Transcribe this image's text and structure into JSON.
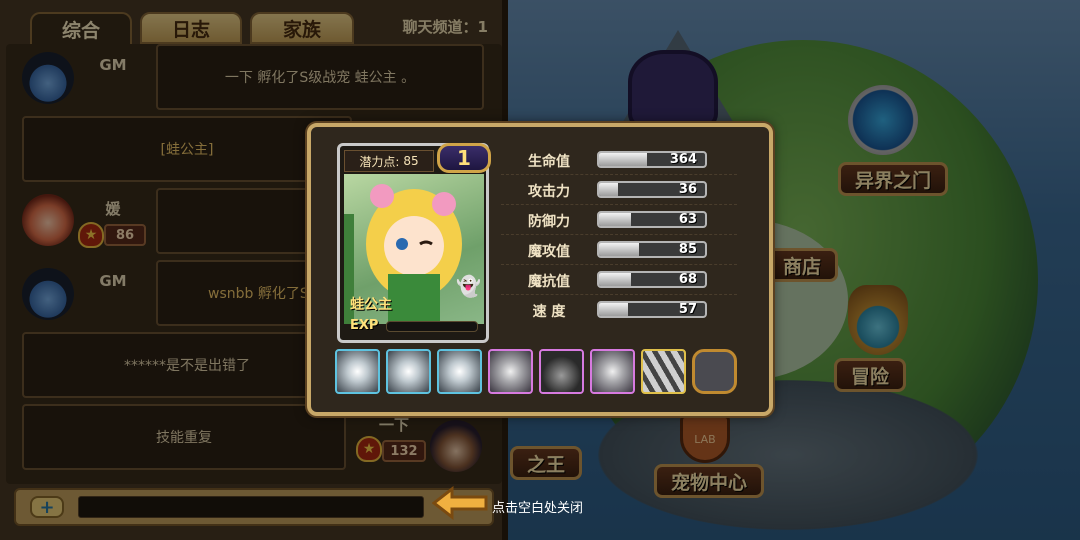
{
  "chat": {
    "tabs": [
      {
        "label": "综合",
        "active": true
      },
      {
        "label": "日志",
        "active": false
      },
      {
        "label": "家族",
        "active": false
      }
    ],
    "channel": "聊天频道：1",
    "messages": [
      {
        "sender": "GM",
        "text": "一下 孵化了S级战宠 蛙公主 。"
      },
      {
        "sender": "",
        "text": "[蛙公主]"
      },
      {
        "sender": "媛",
        "level": "86",
        "text": ""
      },
      {
        "sender": "GM",
        "text": "wsnbb 孵化了S"
      },
      {
        "sender": "",
        "text": "******是不是出错了"
      },
      {
        "sender": "一下",
        "level": "132",
        "text": "技能重复"
      }
    ],
    "input_placeholder": ""
  },
  "overlay": {
    "close_hint": "点击空白处关闭"
  },
  "pet": {
    "potential_label": "潜力点:",
    "potential_value": "85",
    "level": "1",
    "name": "蛙公主",
    "exp_label": "EXP",
    "exp_progress": 0.0,
    "stats": [
      {
        "label": "生命值",
        "value": 364,
        "fill": 0.45
      },
      {
        "label": "攻击力",
        "value": 36,
        "fill": 0.18
      },
      {
        "label": "防御力",
        "value": 63,
        "fill": 0.3
      },
      {
        "label": "魔攻值",
        "value": 85,
        "fill": 0.38
      },
      {
        "label": "魔抗值",
        "value": 68,
        "fill": 0.3
      },
      {
        "label": "速 度",
        "value": 57,
        "fill": 0.27
      }
    ],
    "skills": [
      {
        "icon": "skill-burst-icon",
        "rarity": "blue"
      },
      {
        "icon": "skill-burst-icon",
        "rarity": "blue"
      },
      {
        "icon": "skill-spikes-icon",
        "rarity": "blue"
      },
      {
        "icon": "skill-spikes-icon",
        "rarity": "purple"
      },
      {
        "icon": "skill-dark-icon",
        "rarity": "purple"
      },
      {
        "icon": "skill-star-icon",
        "rarity": "purple"
      },
      {
        "icon": "skill-blades-icon",
        "rarity": "gold"
      },
      {
        "icon": "empty-skill-slot-icon",
        "rarity": "empty"
      }
    ]
  },
  "map": {
    "buttons": {
      "other_world": "异界之门",
      "shop": "商店",
      "adventure": "冒险",
      "king": "之王",
      "pet_center": "宠物中心"
    }
  }
}
